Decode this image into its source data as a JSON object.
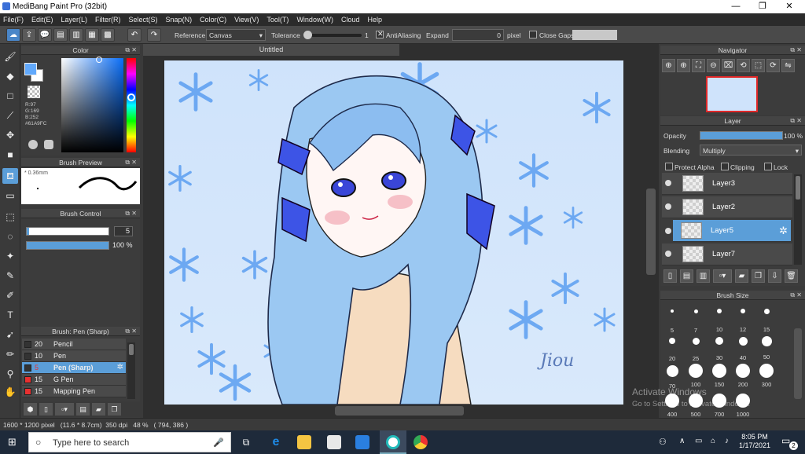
{
  "window": {
    "title": "MediBang Paint Pro (32bit)",
    "min": "—",
    "max": "❐",
    "close": "✕"
  },
  "menu": [
    "File(F)",
    "Edit(E)",
    "Layer(L)",
    "Filter(R)",
    "Select(S)",
    "Snap(N)",
    "Color(C)",
    "View(V)",
    "Tool(T)",
    "Window(W)",
    "Cloud",
    "Help"
  ],
  "toolbar": {
    "reference_label": "Reference",
    "reference_value": "Canvas",
    "tolerance_label": "Tolerance",
    "tolerance_value": "1",
    "antialiasing_label": "AntiAliasing",
    "expand_label": "Expand",
    "expand_value": "0",
    "expand_unit": "pixel",
    "close_gaps_label": "Close Gaps"
  },
  "color_panel": {
    "title": "Color",
    "r": "R:97",
    "g": "G:169",
    "b": "B:252",
    "hex": "#61A9FC",
    "fg_color": "#61a9fc",
    "bg_color": "#ffffff"
  },
  "brush_preview": {
    "title": "Brush Preview",
    "size": "0.36mm"
  },
  "brush_control": {
    "title": "Brush Control",
    "size_value": "5",
    "opacity_value": "100 %",
    "size_fraction": 0.03,
    "opacity_fraction": 1.0
  },
  "brush_panel": {
    "title": "Brush: Pen (Sharp)",
    "items": [
      {
        "num": "20",
        "name": "Pencil",
        "color": "#333333"
      },
      {
        "num": "10",
        "name": "Pen",
        "color": "#333333"
      },
      {
        "num": "5",
        "name": "Pen (Sharp)",
        "color": "#333333",
        "selected": true
      },
      {
        "num": "15",
        "name": "G Pen",
        "color": "#e83030"
      },
      {
        "num": "15",
        "name": "Mapping Pen",
        "color": "#e83030"
      }
    ]
  },
  "document": {
    "tab": "Untitled",
    "signature": "Jiou"
  },
  "navigator": {
    "title": "Navigator"
  },
  "layer_panel": {
    "title": "Layer",
    "opacity_label": "Opacity",
    "opacity_value": "100 %",
    "blending_label": "Blending",
    "blending_value": "Multiply",
    "protect_alpha": "Protect Alpha",
    "clipping": "Clipping",
    "lock": "Lock",
    "layers": [
      {
        "name": "Layer3"
      },
      {
        "name": "Layer2"
      },
      {
        "name": "Layer5",
        "selected": true
      },
      {
        "name": "Layer7"
      }
    ]
  },
  "brush_size": {
    "title": "Brush Size",
    "sizes": [
      "5",
      "7",
      "10",
      "12",
      "15",
      "20",
      "25",
      "30",
      "40",
      "50",
      "70",
      "100",
      "150",
      "200",
      "300",
      "400",
      "500",
      "700",
      "1000"
    ]
  },
  "status": {
    "info": "1600 * 1200 pixel   (11.6 * 8.7cm)  350 dpi   48 %   ( 794, 386 )"
  },
  "watermark": {
    "line1": "Activate Windows",
    "line2": "Go to Settings to activate Windows."
  },
  "taskbar": {
    "search_placeholder": "Type here to search",
    "time": "8:05 PM",
    "date": "1/17/2021",
    "notif": "2"
  }
}
